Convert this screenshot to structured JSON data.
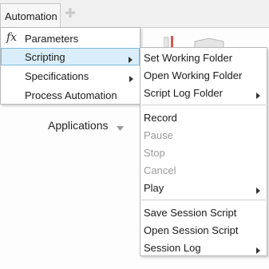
{
  "tabbar": {
    "active_tab": "Automation",
    "add_icon": "plus-icon"
  },
  "ribbon": {
    "applications_label": "Applications"
  },
  "menu1": {
    "items": [
      {
        "label": "Parameters",
        "icon": "fx-icon",
        "icon_text": "fx"
      },
      {
        "label": "Scripting",
        "has_submenu": true,
        "highlighted": true
      },
      {
        "label": "Specifications",
        "has_submenu": true
      },
      {
        "label": "Process Automation"
      }
    ]
  },
  "menu2": {
    "items": [
      {
        "label": "Set Working Folder"
      },
      {
        "label": "Open Working Folder"
      },
      {
        "label": "Script Log Folder",
        "has_submenu": true
      },
      {
        "label": "Record"
      },
      {
        "label": "Pause",
        "disabled": true
      },
      {
        "label": "Stop",
        "disabled": true
      },
      {
        "label": "Cancel",
        "disabled": true
      },
      {
        "label": "Play",
        "has_submenu": true
      },
      {
        "label": "Save Session Script"
      },
      {
        "label": "Open Session Script"
      },
      {
        "label": "Session Log",
        "has_submenu": true
      }
    ]
  },
  "colors": {
    "highlight_bg": "#d9eefa",
    "highlight_border": "#7dbbe3",
    "disabled_text": "#9a9a9a"
  }
}
